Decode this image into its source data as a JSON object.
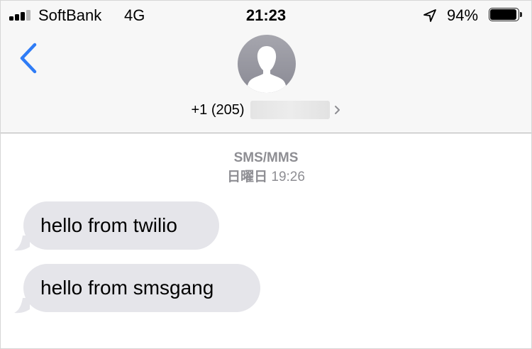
{
  "status_bar": {
    "carrier": "SoftBank",
    "network": "4G",
    "time": "21:23",
    "battery_percent": "94%",
    "battery_level": 0.94,
    "signal_bars_active": 3,
    "signal_bars_total": 4
  },
  "header": {
    "contact_number": "+1 (205)"
  },
  "conversation": {
    "service": "SMS/MMS",
    "timestamp_day": "日曜日",
    "timestamp_time": "19:26",
    "messages": [
      {
        "text": "hello from twilio"
      },
      {
        "text": "hello from smsgang"
      }
    ]
  },
  "colors": {
    "accent": "#2f7cf6",
    "bubble": "#e5e5ea",
    "header_bg": "#f7f7f7",
    "secondary_text": "#8e8e93"
  },
  "icons": [
    "signal-icon",
    "location-arrow-icon",
    "battery-icon",
    "back-chevron-icon",
    "contact-avatar-icon",
    "chevron-right-icon"
  ]
}
